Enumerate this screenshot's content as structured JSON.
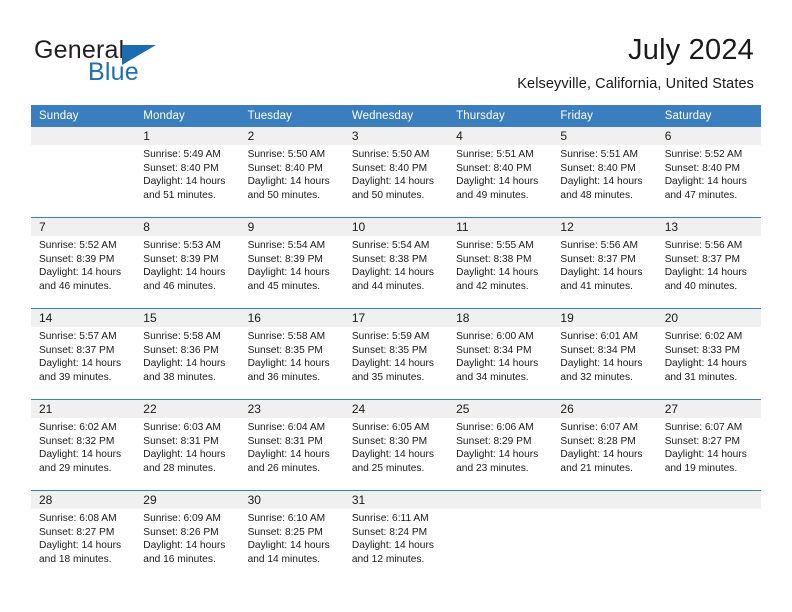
{
  "brand": {
    "name_part1": "General",
    "name_part2": "Blue",
    "logo_icon": "blue-triangle-icon"
  },
  "header": {
    "title": "July 2024",
    "subtitle": "Kelseyville, California, United States"
  },
  "colors": {
    "header_blue": "#3a7ebf",
    "brand_blue": "#1f6fb5",
    "day_band_gray": "#f0f0f0",
    "text": "#1a1a1a"
  },
  "calendar": {
    "weekday_headers": [
      "Sunday",
      "Monday",
      "Tuesday",
      "Wednesday",
      "Thursday",
      "Friday",
      "Saturday"
    ],
    "labels": {
      "sunrise": "Sunrise:",
      "sunset": "Sunset:",
      "daylight": "Daylight:"
    },
    "weeks": [
      [
        {
          "day": "",
          "empty": true
        },
        {
          "day": "1",
          "sunrise": "Sunrise: 5:49 AM",
          "sunset": "Sunset: 8:40 PM",
          "daylight1": "Daylight: 14 hours",
          "daylight2": "and 51 minutes."
        },
        {
          "day": "2",
          "sunrise": "Sunrise: 5:50 AM",
          "sunset": "Sunset: 8:40 PM",
          "daylight1": "Daylight: 14 hours",
          "daylight2": "and 50 minutes."
        },
        {
          "day": "3",
          "sunrise": "Sunrise: 5:50 AM",
          "sunset": "Sunset: 8:40 PM",
          "daylight1": "Daylight: 14 hours",
          "daylight2": "and 50 minutes."
        },
        {
          "day": "4",
          "sunrise": "Sunrise: 5:51 AM",
          "sunset": "Sunset: 8:40 PM",
          "daylight1": "Daylight: 14 hours",
          "daylight2": "and 49 minutes."
        },
        {
          "day": "5",
          "sunrise": "Sunrise: 5:51 AM",
          "sunset": "Sunset: 8:40 PM",
          "daylight1": "Daylight: 14 hours",
          "daylight2": "and 48 minutes."
        },
        {
          "day": "6",
          "sunrise": "Sunrise: 5:52 AM",
          "sunset": "Sunset: 8:40 PM",
          "daylight1": "Daylight: 14 hours",
          "daylight2": "and 47 minutes."
        }
      ],
      [
        {
          "day": "7",
          "sunrise": "Sunrise: 5:52 AM",
          "sunset": "Sunset: 8:39 PM",
          "daylight1": "Daylight: 14 hours",
          "daylight2": "and 46 minutes."
        },
        {
          "day": "8",
          "sunrise": "Sunrise: 5:53 AM",
          "sunset": "Sunset: 8:39 PM",
          "daylight1": "Daylight: 14 hours",
          "daylight2": "and 46 minutes."
        },
        {
          "day": "9",
          "sunrise": "Sunrise: 5:54 AM",
          "sunset": "Sunset: 8:39 PM",
          "daylight1": "Daylight: 14 hours",
          "daylight2": "and 45 minutes."
        },
        {
          "day": "10",
          "sunrise": "Sunrise: 5:54 AM",
          "sunset": "Sunset: 8:38 PM",
          "daylight1": "Daylight: 14 hours",
          "daylight2": "and 44 minutes."
        },
        {
          "day": "11",
          "sunrise": "Sunrise: 5:55 AM",
          "sunset": "Sunset: 8:38 PM",
          "daylight1": "Daylight: 14 hours",
          "daylight2": "and 42 minutes."
        },
        {
          "day": "12",
          "sunrise": "Sunrise: 5:56 AM",
          "sunset": "Sunset: 8:37 PM",
          "daylight1": "Daylight: 14 hours",
          "daylight2": "and 41 minutes."
        },
        {
          "day": "13",
          "sunrise": "Sunrise: 5:56 AM",
          "sunset": "Sunset: 8:37 PM",
          "daylight1": "Daylight: 14 hours",
          "daylight2": "and 40 minutes."
        }
      ],
      [
        {
          "day": "14",
          "sunrise": "Sunrise: 5:57 AM",
          "sunset": "Sunset: 8:37 PM",
          "daylight1": "Daylight: 14 hours",
          "daylight2": "and 39 minutes."
        },
        {
          "day": "15",
          "sunrise": "Sunrise: 5:58 AM",
          "sunset": "Sunset: 8:36 PM",
          "daylight1": "Daylight: 14 hours",
          "daylight2": "and 38 minutes."
        },
        {
          "day": "16",
          "sunrise": "Sunrise: 5:58 AM",
          "sunset": "Sunset: 8:35 PM",
          "daylight1": "Daylight: 14 hours",
          "daylight2": "and 36 minutes."
        },
        {
          "day": "17",
          "sunrise": "Sunrise: 5:59 AM",
          "sunset": "Sunset: 8:35 PM",
          "daylight1": "Daylight: 14 hours",
          "daylight2": "and 35 minutes."
        },
        {
          "day": "18",
          "sunrise": "Sunrise: 6:00 AM",
          "sunset": "Sunset: 8:34 PM",
          "daylight1": "Daylight: 14 hours",
          "daylight2": "and 34 minutes."
        },
        {
          "day": "19",
          "sunrise": "Sunrise: 6:01 AM",
          "sunset": "Sunset: 8:34 PM",
          "daylight1": "Daylight: 14 hours",
          "daylight2": "and 32 minutes."
        },
        {
          "day": "20",
          "sunrise": "Sunrise: 6:02 AM",
          "sunset": "Sunset: 8:33 PM",
          "daylight1": "Daylight: 14 hours",
          "daylight2": "and 31 minutes."
        }
      ],
      [
        {
          "day": "21",
          "sunrise": "Sunrise: 6:02 AM",
          "sunset": "Sunset: 8:32 PM",
          "daylight1": "Daylight: 14 hours",
          "daylight2": "and 29 minutes."
        },
        {
          "day": "22",
          "sunrise": "Sunrise: 6:03 AM",
          "sunset": "Sunset: 8:31 PM",
          "daylight1": "Daylight: 14 hours",
          "daylight2": "and 28 minutes."
        },
        {
          "day": "23",
          "sunrise": "Sunrise: 6:04 AM",
          "sunset": "Sunset: 8:31 PM",
          "daylight1": "Daylight: 14 hours",
          "daylight2": "and 26 minutes."
        },
        {
          "day": "24",
          "sunrise": "Sunrise: 6:05 AM",
          "sunset": "Sunset: 8:30 PM",
          "daylight1": "Daylight: 14 hours",
          "daylight2": "and 25 minutes."
        },
        {
          "day": "25",
          "sunrise": "Sunrise: 6:06 AM",
          "sunset": "Sunset: 8:29 PM",
          "daylight1": "Daylight: 14 hours",
          "daylight2": "and 23 minutes."
        },
        {
          "day": "26",
          "sunrise": "Sunrise: 6:07 AM",
          "sunset": "Sunset: 8:28 PM",
          "daylight1": "Daylight: 14 hours",
          "daylight2": "and 21 minutes."
        },
        {
          "day": "27",
          "sunrise": "Sunrise: 6:07 AM",
          "sunset": "Sunset: 8:27 PM",
          "daylight1": "Daylight: 14 hours",
          "daylight2": "and 19 minutes."
        }
      ],
      [
        {
          "day": "28",
          "sunrise": "Sunrise: 6:08 AM",
          "sunset": "Sunset: 8:27 PM",
          "daylight1": "Daylight: 14 hours",
          "daylight2": "and 18 minutes."
        },
        {
          "day": "29",
          "sunrise": "Sunrise: 6:09 AM",
          "sunset": "Sunset: 8:26 PM",
          "daylight1": "Daylight: 14 hours",
          "daylight2": "and 16 minutes."
        },
        {
          "day": "30",
          "sunrise": "Sunrise: 6:10 AM",
          "sunset": "Sunset: 8:25 PM",
          "daylight1": "Daylight: 14 hours",
          "daylight2": "and 14 minutes."
        },
        {
          "day": "31",
          "sunrise": "Sunrise: 6:11 AM",
          "sunset": "Sunset: 8:24 PM",
          "daylight1": "Daylight: 14 hours",
          "daylight2": "and 12 minutes."
        },
        {
          "day": "",
          "empty": true
        },
        {
          "day": "",
          "empty": true
        },
        {
          "day": "",
          "empty": true
        }
      ]
    ]
  }
}
